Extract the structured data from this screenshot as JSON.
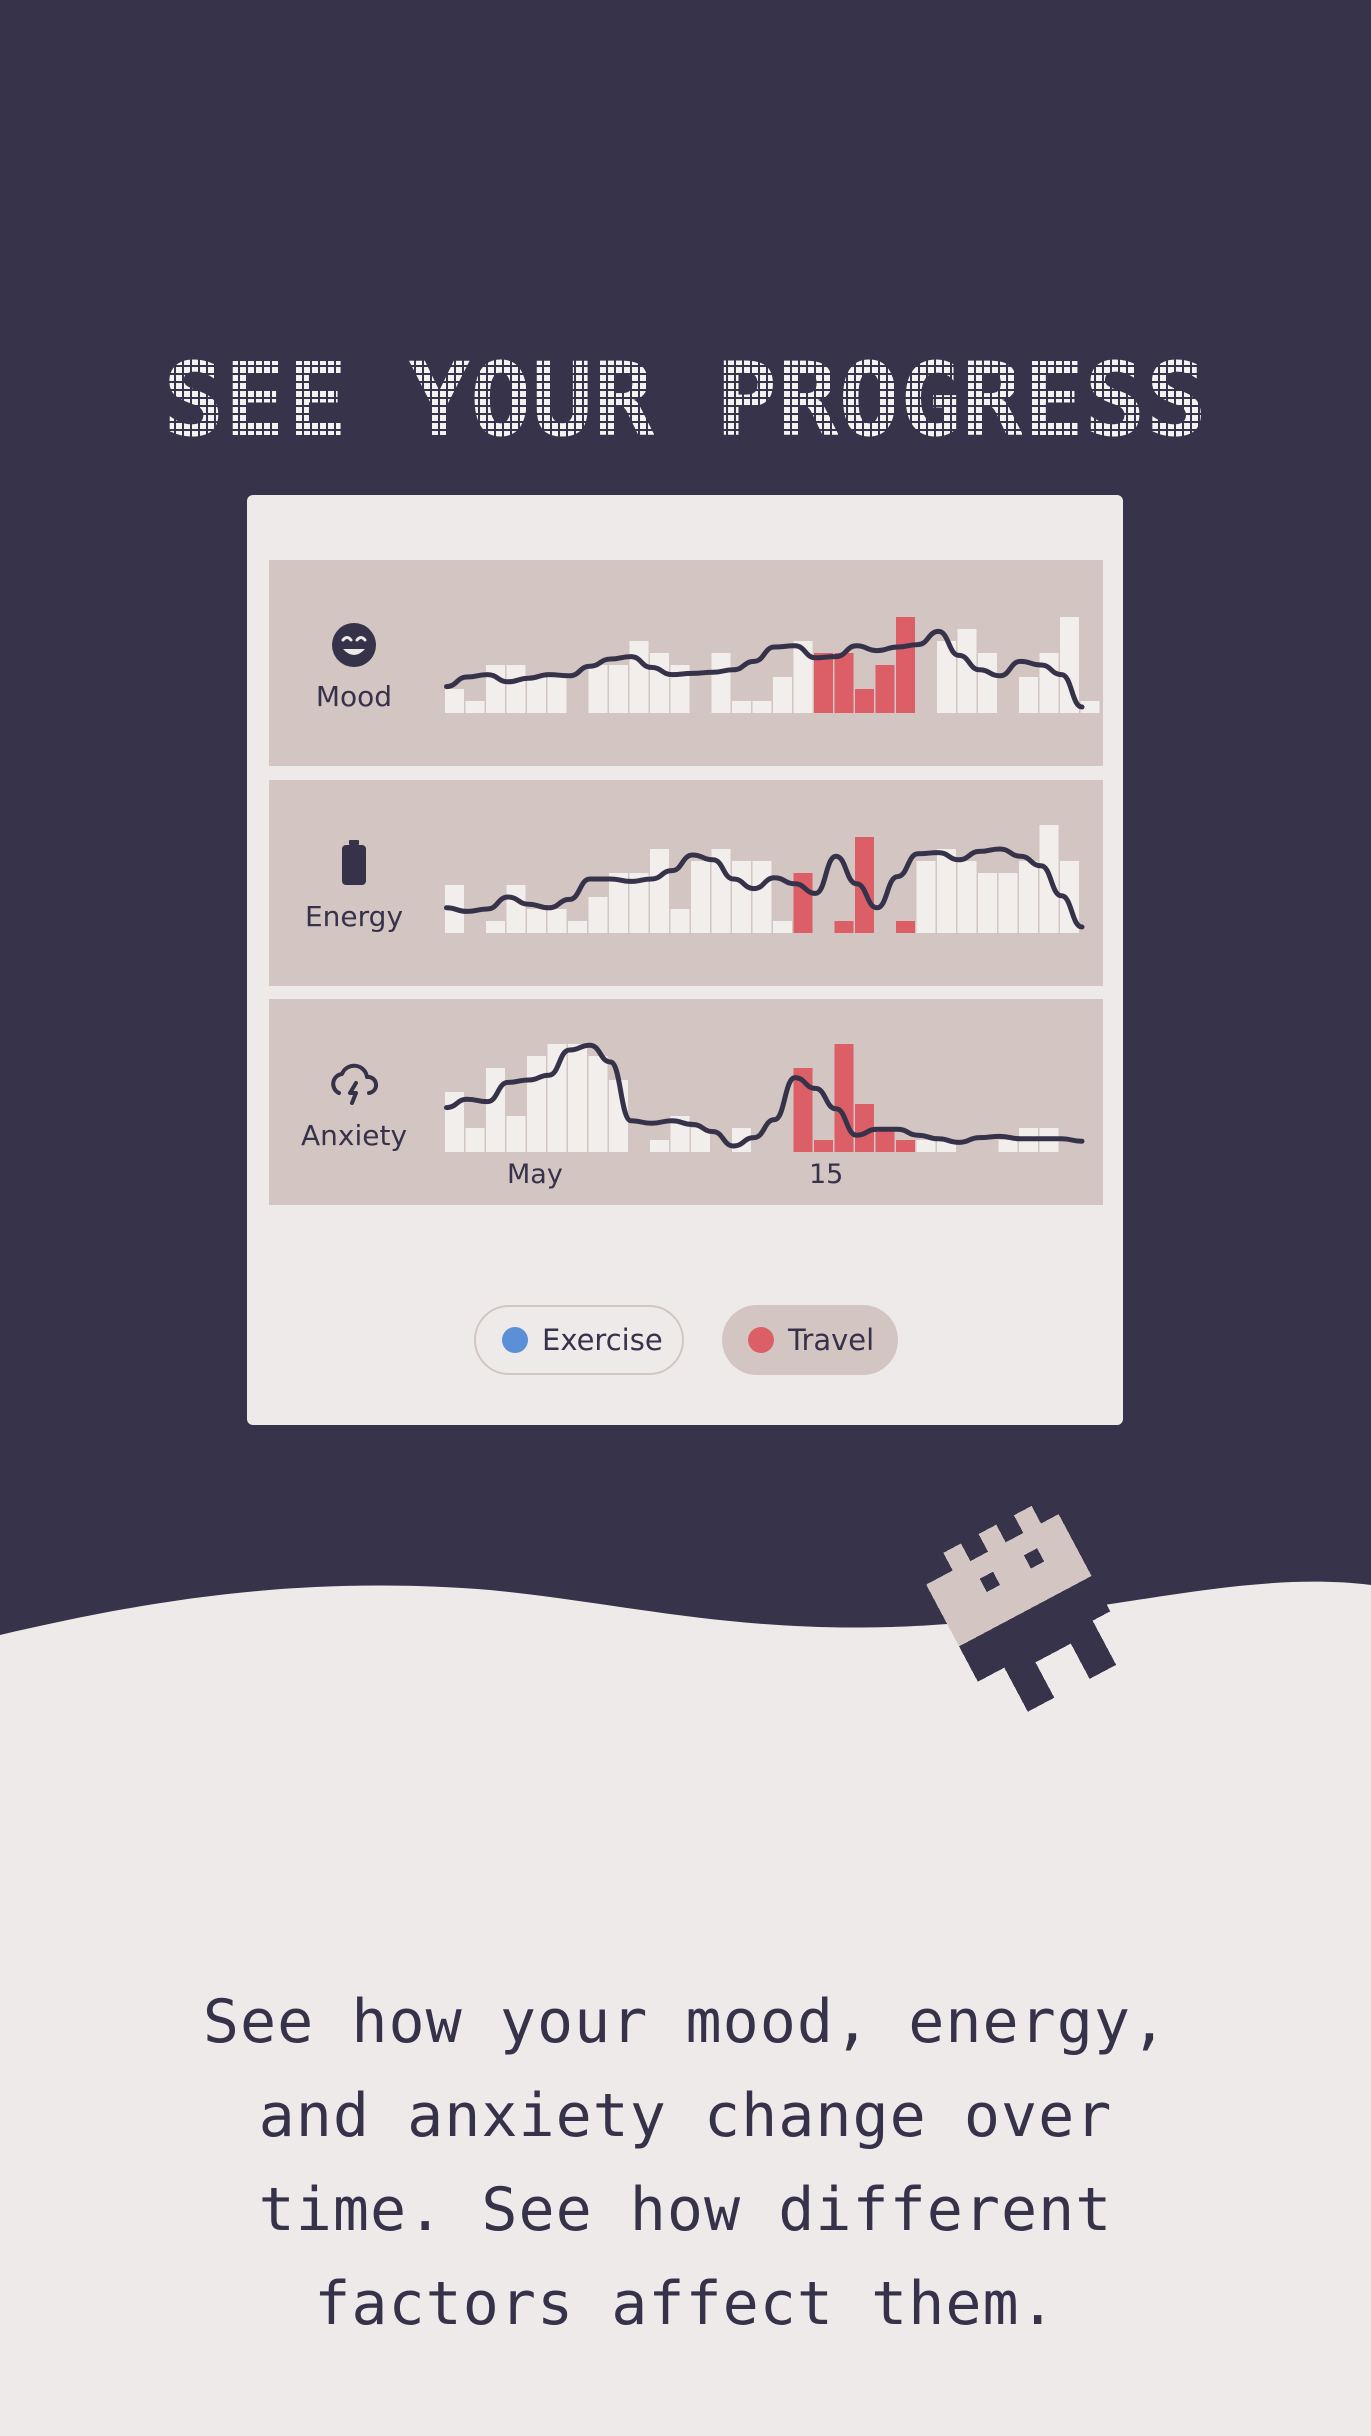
{
  "hero": {
    "title": "SEE YOUR PROGRESS"
  },
  "colors": {
    "dark_bg": "#37334b",
    "light_bg": "#eeeaea",
    "panel": "#d3c6c2",
    "bar": "#f2eeec",
    "travel": "#dc5f67",
    "exercise": "#5b8fd6",
    "line": "#36324a"
  },
  "rows": [
    {
      "label": "Mood",
      "icon": "smiley-icon"
    },
    {
      "label": "Energy",
      "icon": "battery-icon"
    },
    {
      "label": "Anxiety",
      "icon": "storm-cloud-icon"
    }
  ],
  "x_axis": {
    "labels": [
      "May",
      "15"
    ]
  },
  "legend": [
    {
      "label": "Exercise",
      "color": "#5b8fd6",
      "active": false
    },
    {
      "label": "Travel",
      "color": "#dc5f67",
      "active": true
    }
  ],
  "description": "See how your mood, energy,\nand anxiety change over\ntime.  See how different\nfactors affect them.",
  "chart_data": [
    {
      "type": "bar",
      "title": "Mood",
      "values": [
        2,
        1,
        4,
        4,
        3,
        3,
        0,
        4,
        4,
        6,
        5,
        4,
        0,
        5,
        1,
        1,
        3,
        6,
        5,
        5,
        2,
        4,
        8,
        0,
        6,
        7,
        5,
        0,
        3,
        5,
        8,
        1
      ],
      "highlight": [
        0,
        0,
        0,
        0,
        0,
        0,
        0,
        0,
        0,
        0,
        0,
        0,
        0,
        0,
        0,
        0,
        0,
        0,
        1,
        1,
        1,
        1,
        1,
        0,
        0,
        0,
        0,
        0,
        0,
        0,
        0,
        0
      ],
      "trend": [
        2.2,
        3,
        3.2,
        2.6,
        2.9,
        3.2,
        3.1,
        3.9,
        4.5,
        4.7,
        3.8,
        3.2,
        3.3,
        3.4,
        3.6,
        4.3,
        5.5,
        5.6,
        4.6,
        4.7,
        5.6,
        5.2,
        5.5,
        5.7,
        6.8,
        4.8,
        3.6,
        3.1,
        4.3,
        4,
        3.2,
        0.5
      ]
    },
    {
      "type": "bar",
      "title": "Energy",
      "values": [
        4,
        0,
        1,
        4,
        2,
        2,
        1,
        3,
        5,
        5,
        7,
        2,
        6,
        7,
        6,
        6,
        1,
        5,
        0,
        1,
        8,
        0,
        1,
        6,
        7,
        6,
        5,
        5,
        6,
        9,
        6,
        0
      ],
      "highlight": [
        0,
        0,
        0,
        0,
        0,
        0,
        0,
        0,
        0,
        0,
        0,
        0,
        0,
        0,
        0,
        0,
        0,
        1,
        0,
        1,
        1,
        0,
        1,
        0,
        0,
        0,
        0,
        0,
        0,
        0,
        0,
        0
      ],
      "trend": [
        2.1,
        1.8,
        2,
        3,
        2.4,
        2.1,
        2.8,
        4.5,
        4.5,
        4.3,
        4.5,
        5.2,
        6.5,
        6.1,
        4.5,
        3.7,
        4.6,
        4.1,
        3.3,
        6.4,
        4.1,
        2.1,
        4.7,
        6.6,
        6.7,
        6.1,
        6.8,
        7,
        6.4,
        5.6,
        3.1,
        0.5
      ]
    },
    {
      "type": "bar",
      "title": "Anxiety",
      "values": [
        5,
        2,
        7,
        3,
        8,
        9,
        9,
        8,
        6,
        0,
        1,
        3,
        2,
        0,
        2,
        0,
        0,
        7,
        1,
        9,
        4,
        2,
        1,
        1,
        1,
        0,
        0,
        1,
        2,
        2,
        0,
        0
      ],
      "highlight": [
        0,
        0,
        0,
        0,
        0,
        0,
        0,
        0,
        0,
        0,
        0,
        0,
        0,
        0,
        0,
        0,
        0,
        1,
        1,
        1,
        1,
        1,
        1,
        0,
        0,
        0,
        0,
        0,
        0,
        0,
        0,
        0
      ],
      "trend": [
        3.7,
        4.4,
        4.2,
        5.8,
        6,
        6.4,
        8.5,
        8.9,
        7.5,
        2.6,
        2.4,
        2.6,
        2.3,
        1.7,
        0.5,
        1.2,
        2.7,
        6.2,
        5.3,
        3.6,
        1.4,
        1.9,
        1.9,
        1.4,
        1.1,
        0.8,
        1.2,
        1.3,
        1.1,
        1.1,
        1.1,
        0.9
      ]
    }
  ]
}
